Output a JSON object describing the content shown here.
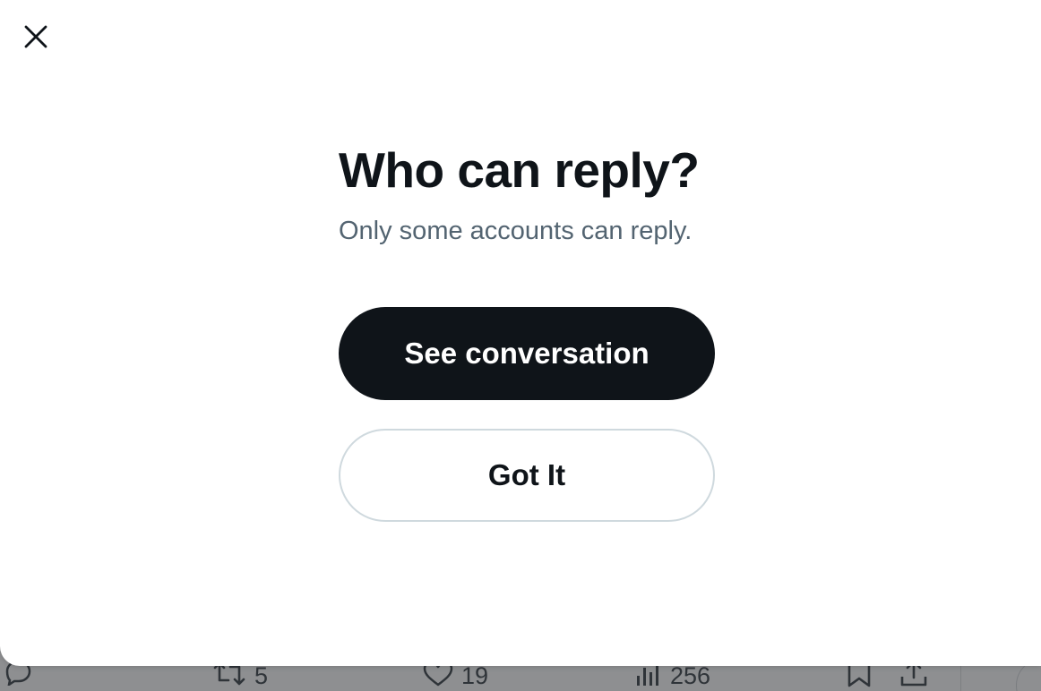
{
  "dialog": {
    "title": "Who can reply?",
    "subtitle": "Only some accounts can reply.",
    "primary_button": "See conversation",
    "secondary_button": "Got It",
    "close_icon": "close-icon"
  },
  "background_actions": {
    "reply": {
      "icon": "reply-icon",
      "count": ""
    },
    "retweet": {
      "icon": "retweet-icon",
      "count": "5"
    },
    "like": {
      "icon": "heart-icon",
      "count": "19"
    },
    "views": {
      "icon": "views-icon",
      "count": "256"
    },
    "bookmark": {
      "icon": "bookmark-icon"
    },
    "share": {
      "icon": "share-icon"
    }
  },
  "colors": {
    "text_primary": "#0f1419",
    "text_secondary": "#536471",
    "primary_button_bg": "#0f1419",
    "secondary_button_border": "#cfd9de",
    "overlay": "#8f9092"
  }
}
